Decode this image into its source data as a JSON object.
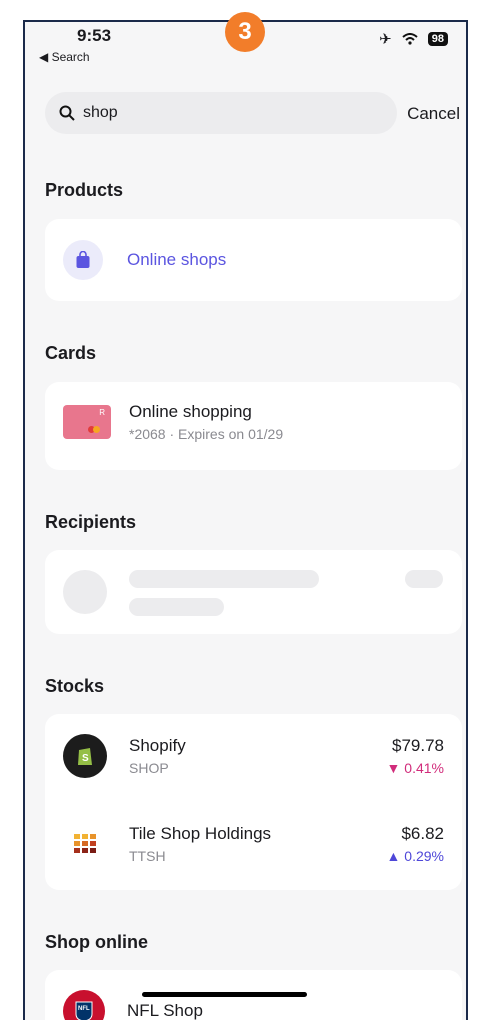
{
  "step_badge": "3",
  "status": {
    "time": "9:53",
    "back_label": "◀ Search",
    "airplane": "airplane-icon",
    "wifi": "wifi-icon",
    "battery": "98"
  },
  "search": {
    "value": "shop",
    "cancel_label": "Cancel",
    "icon": "magnifier-icon"
  },
  "sections": {
    "products": {
      "title": "Products",
      "items": [
        {
          "label": "Online shops",
          "icon": "shopping-bag-icon",
          "color": "#5b55e0"
        }
      ]
    },
    "cards": {
      "title": "Cards",
      "items": [
        {
          "name": "Online shopping",
          "detail": "*2068 · Expires on 01/29",
          "card_color": "#e8768d"
        }
      ]
    },
    "recipients": {
      "title": "Recipients",
      "loading": true
    },
    "stocks": {
      "title": "Stocks",
      "items": [
        {
          "name": "Shopify",
          "ticker": "SHOP",
          "price": "$79.78",
          "change": "▼ 0.41%",
          "change_color": "#d12c7b",
          "icon": "shopify-logo-icon"
        },
        {
          "name": "Tile Shop Holdings",
          "ticker": "TTSH",
          "price": "$6.82",
          "change": "▲ 0.29%",
          "change_color": "#4e47d8",
          "icon": "tile-shop-logo-icon"
        }
      ]
    },
    "shop_online": {
      "title": "Shop online",
      "items": [
        {
          "name": "NFL Shop",
          "icon": "nfl-logo-icon"
        }
      ]
    }
  }
}
